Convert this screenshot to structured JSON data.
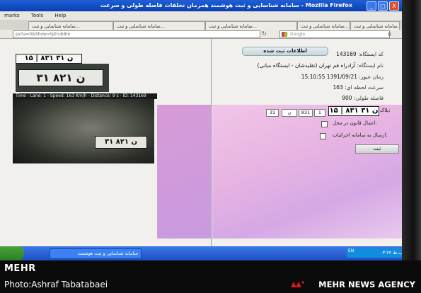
{
  "window": {
    "title": "سامانه شناسایی و ثبت هوشمند همزمان تخلفات فاصله طولی و سرعت - Mozilla Firefox",
    "buttons": [
      "_",
      "□",
      "X"
    ]
  },
  "menu": [
    "marks",
    "Tools",
    "Help"
  ],
  "tabs": [
    "سامانه شناسایی و ثبت...",
    "سامانه شناسایی و ثبت...",
    "سامانه شناسایی و ثبت...",
    "سامانه شناسایی و ثبت...",
    "سامانه شناسایی و ثبت..."
  ],
  "nav": {
    "url": "px?a=0&Show=tptrub9m",
    "search_placeholder": "Google"
  },
  "left_panel": {
    "plate_text": "۱۵ | ۸۳۱ ن ۳۱",
    "plate_crop_text": "۳۱ ن ۸۲۱",
    "camera_overlay": "Time - Lane: 1 - Speed: 163 Km/h - Distance: 9 s - ID: 143169",
    "camera_plate_text": "۳۱ ن ۸۲۱"
  },
  "info": {
    "heading": "اطلاعات ثبت شده",
    "rows": [
      {
        "label": "کد ایستگاه:",
        "value": "143169"
      },
      {
        "label": "نام ایستگاه:",
        "value": "آزادراه قم تهران (تقلیدشان - ایستگاه مبانی)"
      },
      {
        "label": "زمان عبور:",
        "value": "1391/09/21 15:10:55"
      },
      {
        "label": "سرعت لحظه ای:",
        "value": "163"
      },
      {
        "label": "فاصله طولی:",
        "value": "900"
      }
    ]
  },
  "form": {
    "plate_label": "پلاک:",
    "plate_value": "۱۵ | ۸۳۱ ن ۳۱",
    "inputs": [
      "1",
      "831",
      "ن",
      "31"
    ],
    "checkbox1": "اعمال قانون در محل:",
    "checkbox2": "ارسال به سامانه اجرائیات:",
    "submit": "ثبت"
  },
  "taskbar": {
    "task_label": "سامانه شناسایی و ثبت هوشمند",
    "lang": "EN",
    "clock": "۰۳:۲۴ ب.ظ"
  },
  "watermark": {
    "brand": "MEHR",
    "credit": "Photo:Ashraf Tabatabaei",
    "agency": "MEHR NEWS AGENCY"
  }
}
